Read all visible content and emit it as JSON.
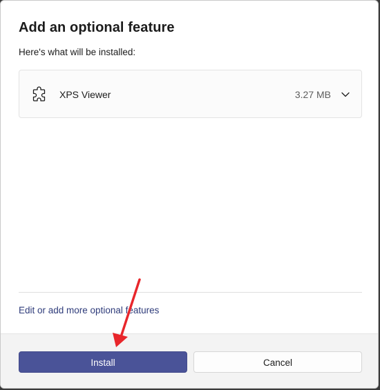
{
  "dialog": {
    "title": "Add an optional feature",
    "subtitle": "Here's what will be installed:"
  },
  "feature": {
    "icon": "puzzle-icon",
    "name": "XPS Viewer",
    "size": "3.27 MB",
    "expand_icon": "chevron-down-icon"
  },
  "link": {
    "label": "Edit or add more optional features"
  },
  "buttons": {
    "install": "Install",
    "cancel": "Cancel"
  },
  "annotation": {
    "color": "#e8262b"
  },
  "colors": {
    "accent": "#4a5398",
    "link": "#2e3b7a"
  }
}
